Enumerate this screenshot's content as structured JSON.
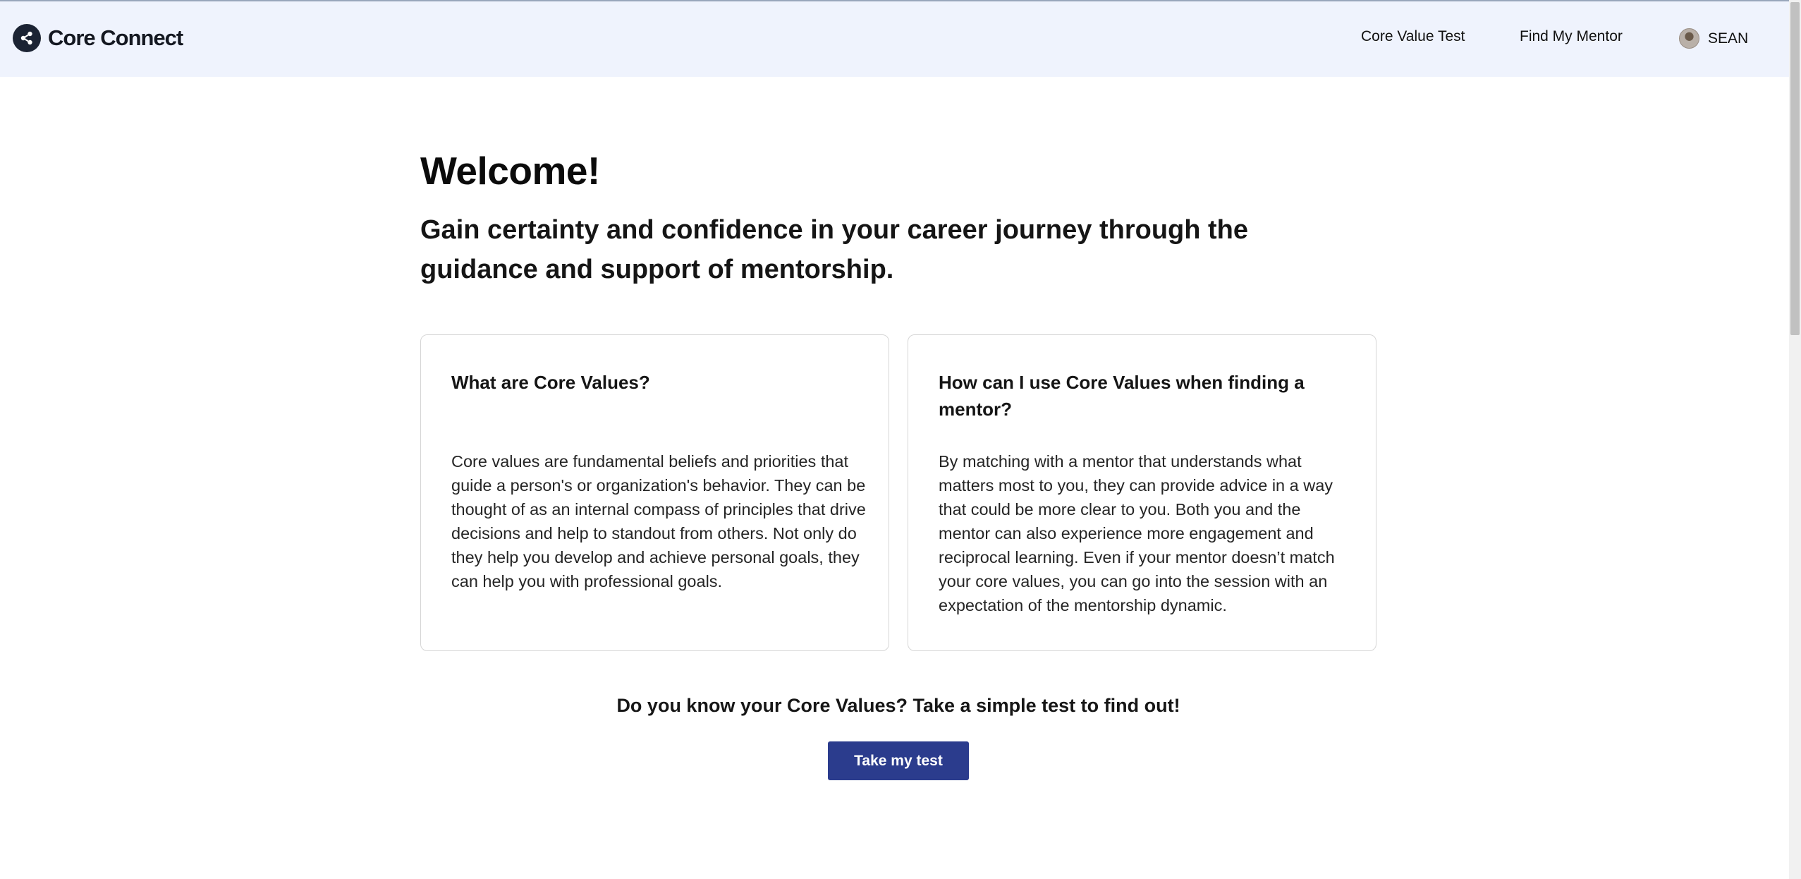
{
  "header": {
    "brand": "Core Connect",
    "brand_icon": "share-icon",
    "nav": [
      "Core Value Test",
      "Find My Mentor"
    ],
    "user": {
      "name": "SEAN",
      "avatar_icon": "avatar"
    }
  },
  "hero": {
    "title": "Welcome!",
    "subtitle": "Gain certainty and confidence in your career journey through the guidance and support of mentorship."
  },
  "cards": [
    {
      "title": "What are Core Values?",
      "body": "Core values are fundamental beliefs and priorities that guide a person's or organization's behavior. They can be thought of as an internal compass of principles that drive decisions and help to standout from others. Not only do they help you develop and achieve personal goals, they can help you with professional goals."
    },
    {
      "title": "How can I use Core Values when finding a mentor?",
      "body": "By matching with a mentor that understands what matters most to you, they can provide advice in a way that could be more clear to you. Both you and the mentor can also experience more engagement and reciprocal learning. Even if your mentor doesn’t match your core values, you can go into the session with an expectation of the mentorship dynamic."
    }
  ],
  "cta": {
    "prompt": "Do you know your Core Values? Take a simple test to find out!",
    "button": "Take my test"
  },
  "colors": {
    "header_bg": "#eff3fd",
    "button_bg": "#2b3c8d",
    "brand_icon_bg": "#1b2333"
  }
}
